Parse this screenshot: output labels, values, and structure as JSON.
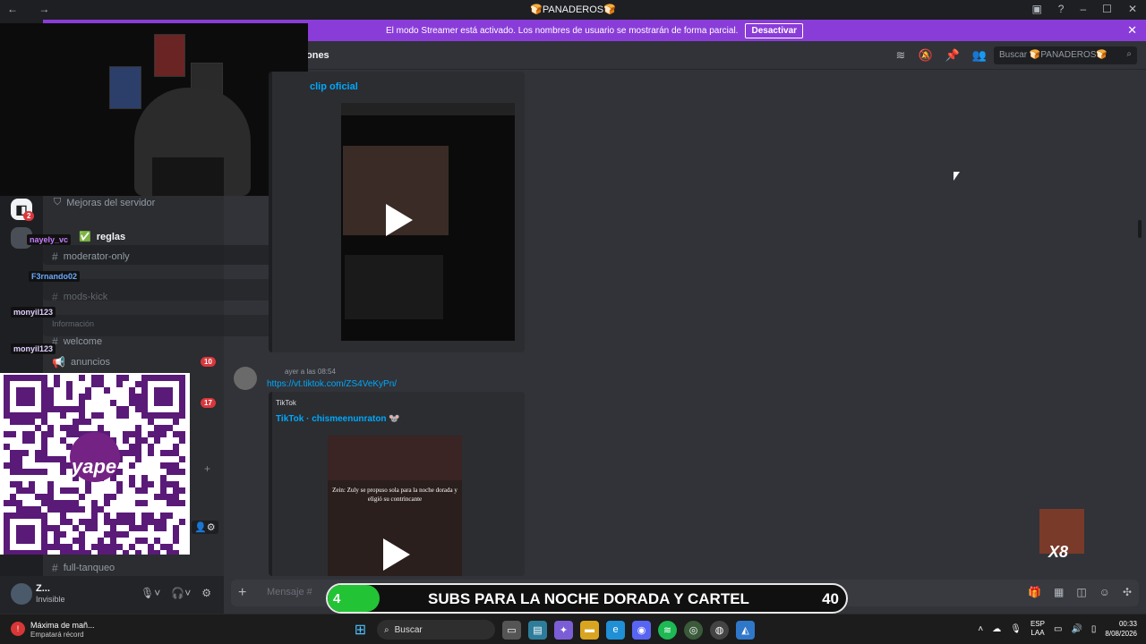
{
  "titlebar": {
    "title": "🍞PANADEROS🍞",
    "nav": "← →"
  },
  "banner": {
    "text": "El modo Streamer está activado. Los nombres de usuario se mostrarán de forma parcial.",
    "button": "Desactivar",
    "close": "✕"
  },
  "header": {
    "channel": "ones",
    "search_placeholder": "Buscar 🍞PANADEROS🍞"
  },
  "sidebar": {
    "boost": "Mejoras del servidor",
    "channels": [
      {
        "name": "reglas"
      },
      {
        "name": "moderator-only"
      },
      {
        "name": "mods-kick"
      },
      {
        "name": "welcome"
      },
      {
        "name": "anuncios"
      },
      {
        "name": "full-tanqueo"
      }
    ],
    "category": "Información",
    "anuncios_badge": "10",
    "other_badge": "17",
    "rail_badge": "2"
  },
  "nicks": [
    "nayely_vc",
    "F3rnando02",
    "monyil123",
    "monyil123"
  ],
  "messages": {
    "first_embed_title": "clip oficial",
    "second_author": "ayer a las 08:54",
    "second_link": "https://vt.tiktok.com/ZS4VeKyPn/",
    "second_provider": "TikTok",
    "second_title": "TikTok · chismeenunraton 🐭",
    "second_caption": "Zein: Zuly se propuso sola para la noche dorada y eligió su contrincante"
  },
  "user": {
    "name": "Z...",
    "status": "Invisible"
  },
  "composer": {
    "placeholder": "Mensaje #"
  },
  "subs": {
    "current": "4",
    "text": "SUBS PARA LA NOCHE DORADA Y CARTEL",
    "goal": "40",
    "progress": 0.1
  },
  "qr": {
    "brand": "yape"
  },
  "emote": {
    "text": "X8"
  },
  "taskbar": {
    "weather_title": "Máxima de mañ...",
    "weather_sub": "Empatará récord",
    "search": "Buscar",
    "lang1": "ESP",
    "lang2": "LAA",
    "time": "00:33",
    "date": "8/08/2026"
  },
  "colors": {
    "accent": "#8a3cd8",
    "link": "#00a8fc",
    "progress": "#22c435"
  }
}
